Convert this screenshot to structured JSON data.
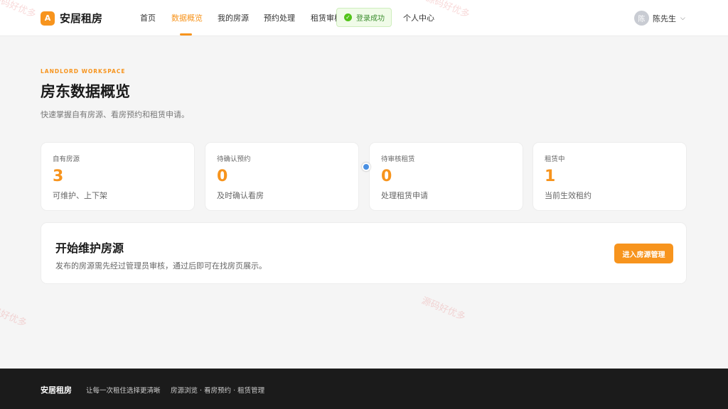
{
  "header": {
    "brand_logo": "A",
    "brand_name": "安居租房",
    "nav": [
      {
        "label": "首页",
        "active": false
      },
      {
        "label": "数据概览",
        "active": true
      },
      {
        "label": "我的房源",
        "active": false
      },
      {
        "label": "预约处理",
        "active": false
      },
      {
        "label": "租赁审核",
        "active": false
      },
      {
        "label": "个人中心",
        "active": false
      }
    ],
    "toast": {
      "icon": "check-circle-icon",
      "text": "登录成功"
    },
    "user": {
      "avatar_text": "陈",
      "name": "陈先生",
      "chevron": "⌵"
    }
  },
  "main": {
    "eyebrow": "LANDLORD WORKSPACE",
    "title": "房东数据概览",
    "description": "快速掌握自有房源、看房预约和租赁申请。",
    "stats": [
      {
        "label": "自有房源",
        "value": "3",
        "sub": "可维护、上下架"
      },
      {
        "label": "待确认预约",
        "value": "0",
        "sub": "及时确认看房"
      },
      {
        "label": "待审核租赁",
        "value": "0",
        "sub": "处理租赁申请"
      },
      {
        "label": "租赁中",
        "value": "1",
        "sub": "当前生效租约"
      }
    ],
    "cta": {
      "title": "开始维护房源",
      "description": "发布的房源需先经过管理员审核，通过后即可在找房页展示。",
      "button": "进入房源管理"
    }
  },
  "footer": {
    "brand": "安居租房",
    "slogan": "让每一次租住选择更清晰",
    "links": "房源浏览 · 看房预约 · 租赁管理"
  },
  "watermark": "源码好优多",
  "colors": {
    "accent": "#f7941d",
    "success": "#52c41a",
    "footer_bg": "#1b1b1b"
  }
}
